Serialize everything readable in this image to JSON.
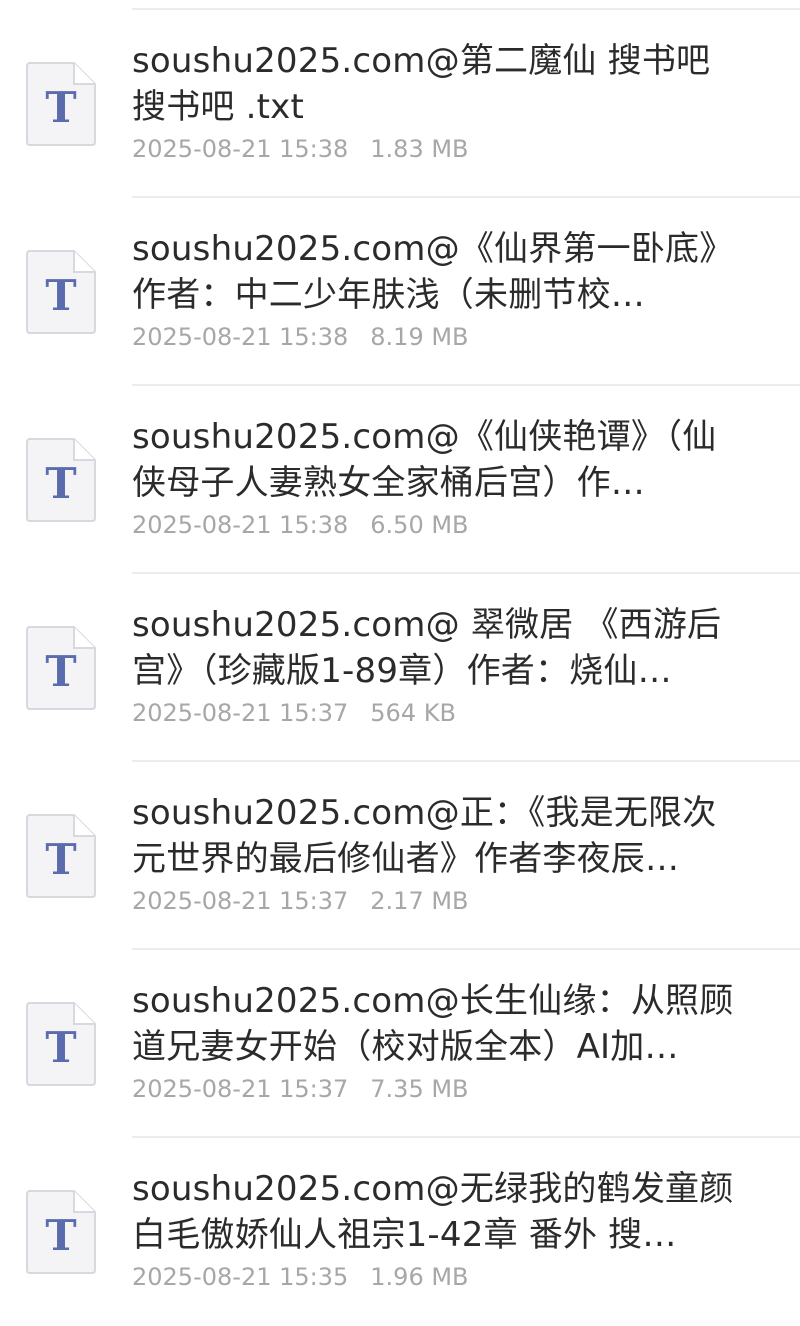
{
  "files": [
    {
      "name": "soushu2025.com@第二魔仙 搜书吧 搜书吧 .txt",
      "date": "2025-08-21 15:38",
      "size": "1.83 MB",
      "icon": "text-file-icon",
      "icon_letter": "T"
    },
    {
      "name": "soushu2025.com@《仙界第一卧底》作者：中二少年肤浅（未删节校…",
      "date": "2025-08-21 15:38",
      "size": "8.19 MB",
      "icon": "text-file-icon",
      "icon_letter": "T"
    },
    {
      "name": "soushu2025.com@《仙侠艳谭》（仙侠母子人妻熟女全家桶后宫）作…",
      "date": "2025-08-21 15:38",
      "size": "6.50 MB",
      "icon": "text-file-icon",
      "icon_letter": "T"
    },
    {
      "name": "soushu2025.com@ 翠微居 《西游后宫》（珍藏版1-89章）作者：烧仙…",
      "date": "2025-08-21 15:37",
      "size": "564 KB",
      "icon": "text-file-icon",
      "icon_letter": "T"
    },
    {
      "name": "soushu2025.com@正：《我是无限次元世界的最后修仙者》作者李夜辰…",
      "date": "2025-08-21 15:37",
      "size": "2.17 MB",
      "icon": "text-file-icon",
      "icon_letter": "T"
    },
    {
      "name": "soushu2025.com@长生仙缘：从照顾道兄妻女开始（校对版全本）AI加…",
      "date": "2025-08-21 15:37",
      "size": "7.35 MB",
      "icon": "text-file-icon",
      "icon_letter": "T"
    },
    {
      "name": "soushu2025.com@无绿我的鹤发童颜白毛傲娇仙人祖宗1-42章 番外 搜…",
      "date": "2025-08-21 15:35",
      "size": "1.96 MB",
      "icon": "text-file-icon",
      "icon_letter": "T"
    }
  ],
  "colors": {
    "icon_letter": "#5b6cae",
    "icon_fill": "#f4f4f6",
    "icon_border": "#d8d8de",
    "name_text": "#2b2b2b",
    "meta_text": "#a7a7a7",
    "divider": "#ececec"
  }
}
